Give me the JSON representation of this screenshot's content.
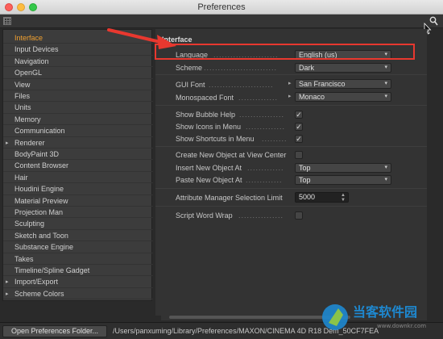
{
  "window": {
    "title": "Preferences"
  },
  "sidebar": {
    "items": [
      {
        "label": "Interface",
        "active": true
      },
      {
        "label": "Input Devices"
      },
      {
        "label": "Navigation"
      },
      {
        "label": "OpenGL"
      },
      {
        "label": "View"
      },
      {
        "label": "Files"
      },
      {
        "label": "Units"
      },
      {
        "label": "Memory"
      },
      {
        "label": "Communication"
      },
      {
        "label": "Renderer",
        "expandable": true
      },
      {
        "label": "BodyPaint 3D"
      },
      {
        "label": "Content Browser"
      },
      {
        "label": "Hair"
      },
      {
        "label": "Houdini Engine"
      },
      {
        "label": "Material Preview"
      },
      {
        "label": "Projection Man"
      },
      {
        "label": "Sculpting"
      },
      {
        "label": "Sketch and Toon"
      },
      {
        "label": "Substance Engine"
      },
      {
        "label": "Takes"
      },
      {
        "label": "Timeline/Spline Gadget"
      },
      {
        "label": "Import/Export",
        "expandable": true
      },
      {
        "label": "Scheme Colors",
        "expandable": true
      }
    ]
  },
  "interface": {
    "section_title": "Interface",
    "language_label": "Language",
    "language_value": "English (us)",
    "scheme_label": "Scheme",
    "scheme_value": "Dark",
    "gui_font_label": "GUI Font",
    "gui_font_value": "San Francisco",
    "mono_font_label": "Monospaced Font",
    "mono_font_value": "Monaco",
    "bubble_help_label": "Show Bubble Help",
    "bubble_help_checked": true,
    "icons_menu_label": "Show Icons in Menu",
    "icons_menu_checked": true,
    "shortcuts_menu_label": "Show Shortcuts in Menu",
    "shortcuts_menu_checked": true,
    "create_center_label": "Create New Object at View Center",
    "create_center_checked": false,
    "insert_at_label": "Insert New Object At",
    "insert_at_value": "Top",
    "paste_at_label": "Paste New Object At",
    "paste_at_value": "Top",
    "attr_limit_label": "Attribute Manager Selection Limit",
    "attr_limit_value": "5000",
    "script_wrap_label": "Script Word Wrap",
    "script_wrap_checked": false
  },
  "bottom": {
    "open_folder_label": "Open Preferences Folder...",
    "path": "/Users/panxuming/Library/Preferences/MAXON/CINEMA 4D R18 Dem_50CF7FEA"
  },
  "icons": {
    "grid": "grid-icon",
    "search": "search-icon",
    "cursor": "cursor-icon",
    "check": "check-icon",
    "chevron": "chevron-updown-icon"
  },
  "colors": {
    "accent_active": "#f0a030",
    "annotation": "#e8382f"
  },
  "watermark": {
    "text": "当客软件园",
    "url": "www.downkr.com"
  }
}
